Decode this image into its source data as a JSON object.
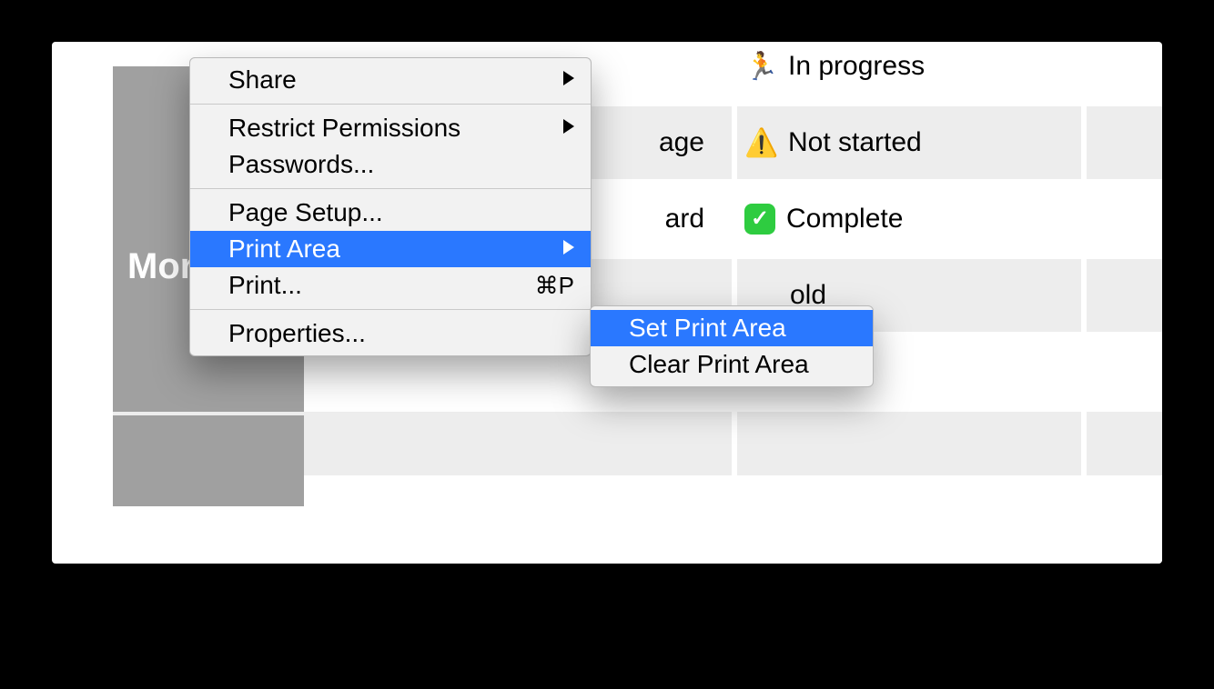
{
  "header_text": "Mor",
  "rows": [
    {
      "task_fragment": "",
      "status_icon": "runner",
      "status_text": "In progress"
    },
    {
      "task_fragment": "age",
      "status_icon": "warning",
      "status_text": "Not started"
    },
    {
      "task_fragment": "ard",
      "status_icon": "check",
      "status_text": "Complete"
    },
    {
      "task_fragment": "",
      "status_icon": "",
      "status_text": "old"
    }
  ],
  "menu": {
    "share": "Share",
    "restrict": "Restrict Permissions",
    "passwords": "Passwords...",
    "page_setup": "Page Setup...",
    "print_area": "Print Area",
    "print": "Print...",
    "print_shortcut": "⌘P",
    "properties": "Properties..."
  },
  "submenu": {
    "set": "Set Print Area",
    "clear": "Clear Print Area"
  }
}
